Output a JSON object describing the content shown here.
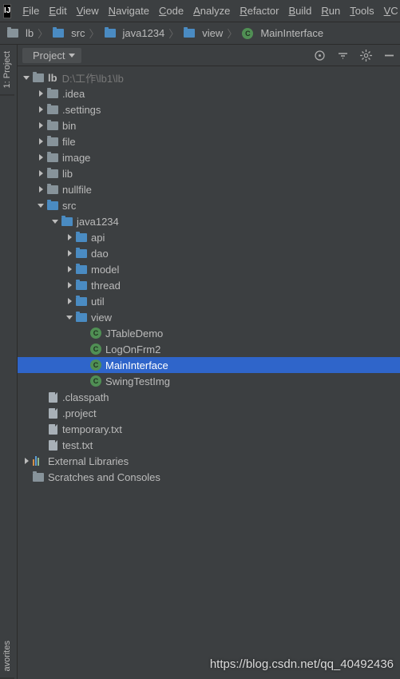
{
  "menu": {
    "items": [
      "File",
      "Edit",
      "View",
      "Navigate",
      "Code",
      "Analyze",
      "Refactor",
      "Build",
      "Run",
      "Tools",
      "VC"
    ]
  },
  "breadcrumb": {
    "items": [
      {
        "icon": "folder",
        "label": "lb"
      },
      {
        "icon": "folder-blue",
        "label": "src"
      },
      {
        "icon": "folder-blue",
        "label": "java1234"
      },
      {
        "icon": "folder-blue",
        "label": "view"
      },
      {
        "icon": "class",
        "label": "MainInterface"
      }
    ]
  },
  "sidetabs": {
    "project": "1: Project",
    "favorites": "avorites"
  },
  "panel": {
    "title": "Project"
  },
  "tree": {
    "nodes": [
      {
        "depth": 0,
        "toggle": "open",
        "icon": "folder",
        "label": "lb",
        "bold": true,
        "hint": "D:\\工作\\lb1\\lb"
      },
      {
        "depth": 1,
        "toggle": "closed",
        "icon": "folder",
        "label": ".idea"
      },
      {
        "depth": 1,
        "toggle": "closed",
        "icon": "folder",
        "label": ".settings"
      },
      {
        "depth": 1,
        "toggle": "closed",
        "icon": "folder",
        "label": "bin"
      },
      {
        "depth": 1,
        "toggle": "closed",
        "icon": "folder",
        "label": "file"
      },
      {
        "depth": 1,
        "toggle": "closed",
        "icon": "folder",
        "label": "image"
      },
      {
        "depth": 1,
        "toggle": "closed",
        "icon": "folder",
        "label": "lib"
      },
      {
        "depth": 1,
        "toggle": "closed",
        "icon": "folder",
        "label": "nullfile"
      },
      {
        "depth": 1,
        "toggle": "open",
        "icon": "folder-blue",
        "label": "src"
      },
      {
        "depth": 2,
        "toggle": "open",
        "icon": "folder-blue",
        "label": "java1234"
      },
      {
        "depth": 3,
        "toggle": "closed",
        "icon": "pkg",
        "label": "api"
      },
      {
        "depth": 3,
        "toggle": "closed",
        "icon": "pkg",
        "label": "dao"
      },
      {
        "depth": 3,
        "toggle": "closed",
        "icon": "pkg",
        "label": "model"
      },
      {
        "depth": 3,
        "toggle": "closed",
        "icon": "pkg",
        "label": "thread"
      },
      {
        "depth": 3,
        "toggle": "closed",
        "icon": "pkg",
        "label": "util"
      },
      {
        "depth": 3,
        "toggle": "open",
        "icon": "pkg",
        "label": "view"
      },
      {
        "depth": 4,
        "toggle": "none",
        "icon": "class",
        "label": "JTableDemo"
      },
      {
        "depth": 4,
        "toggle": "none",
        "icon": "class",
        "label": "LogOnFrm2"
      },
      {
        "depth": 4,
        "toggle": "none",
        "icon": "class",
        "label": "MainInterface",
        "selected": true
      },
      {
        "depth": 4,
        "toggle": "none",
        "icon": "class",
        "label": "SwingTestImg"
      },
      {
        "depth": 1,
        "toggle": "none",
        "icon": "file",
        "label": ".classpath"
      },
      {
        "depth": 1,
        "toggle": "none",
        "icon": "file",
        "label": ".project"
      },
      {
        "depth": 1,
        "toggle": "none",
        "icon": "file",
        "label": "temporary.txt"
      },
      {
        "depth": 1,
        "toggle": "none",
        "icon": "file",
        "label": "test.txt"
      },
      {
        "depth": 0,
        "toggle": "closed",
        "icon": "lib",
        "label": "External Libraries"
      },
      {
        "depth": 0,
        "toggle": "none",
        "icon": "folder",
        "label": "Scratches and Consoles"
      }
    ]
  },
  "watermark": "https://blog.csdn.net/qq_40492436"
}
